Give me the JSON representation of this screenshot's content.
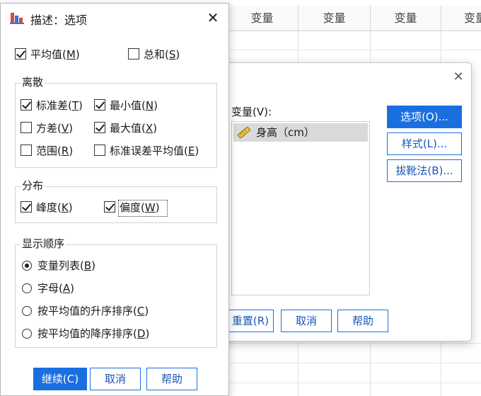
{
  "sheet": {
    "col_headers": [
      "变量",
      "变量",
      "变量",
      "变量"
    ]
  },
  "main_dialog": {
    "close_glyph": "✕",
    "variables_label": "变量(V):",
    "variable_item": "身高（cm）",
    "buttons": {
      "options": "选项(O)...",
      "style": "样式(L)...",
      "bootstrap": "拔靴法(B)..."
    },
    "bottom_buttons": {
      "reset": "重置(R)",
      "cancel": "取消",
      "help": "帮助"
    }
  },
  "options_dialog": {
    "title": "描述：选项",
    "close_glyph": "✕",
    "mean": {
      "label": "平均值",
      "key": "M",
      "checked": true
    },
    "sum": {
      "label": "总和",
      "key": "S",
      "checked": false
    },
    "dispersion": {
      "title": "离散",
      "items": [
        {
          "label": "标准差",
          "key": "T",
          "checked": true
        },
        {
          "label": "最小值",
          "key": "N",
          "checked": true
        },
        {
          "label": "方差",
          "key": "V",
          "checked": false
        },
        {
          "label": "最大值",
          "key": "X",
          "checked": true
        },
        {
          "label": "范围",
          "key": "R",
          "checked": false
        },
        {
          "label": "标准误差平均值",
          "key": "E",
          "checked": false
        }
      ]
    },
    "distribution": {
      "title": "分布",
      "items": [
        {
          "label": "峰度",
          "key": "K",
          "checked": true
        },
        {
          "label": "偏度",
          "key": "W",
          "checked": true
        }
      ]
    },
    "display_order": {
      "title": "显示顺序",
      "items": [
        {
          "label": "变量列表",
          "key": "B",
          "selected": true
        },
        {
          "label": "字母",
          "key": "A",
          "selected": false
        },
        {
          "label": "按平均值的升序排序",
          "key": "C",
          "selected": false
        },
        {
          "label": "按平均值的降序排序",
          "key": "D",
          "selected": false
        }
      ]
    },
    "buttons": {
      "continue": "继续(C)",
      "cancel": "取消",
      "help": "帮助"
    }
  }
}
